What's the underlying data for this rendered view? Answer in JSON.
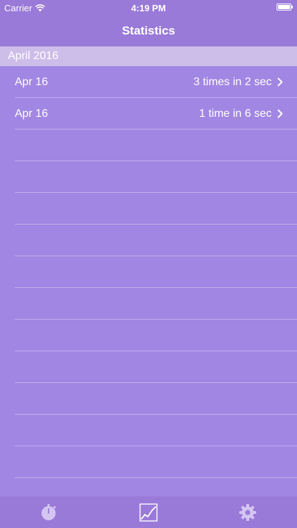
{
  "status_bar": {
    "carrier": "Carrier",
    "time": "4:19 PM"
  },
  "nav": {
    "title": "Statistics"
  },
  "section": {
    "header": "April 2016"
  },
  "rows": [
    {
      "date": "Apr 16",
      "summary": "3 times in 2 sec"
    },
    {
      "date": "Apr 16",
      "summary": "1 time in 6 sec"
    },
    {
      "date": "",
      "summary": ""
    },
    {
      "date": "",
      "summary": ""
    },
    {
      "date": "",
      "summary": ""
    },
    {
      "date": "",
      "summary": ""
    },
    {
      "date": "",
      "summary": ""
    },
    {
      "date": "",
      "summary": ""
    },
    {
      "date": "",
      "summary": ""
    },
    {
      "date": "",
      "summary": ""
    },
    {
      "date": "",
      "summary": ""
    },
    {
      "date": "",
      "summary": ""
    },
    {
      "date": "",
      "summary": ""
    },
    {
      "date": "",
      "summary": ""
    }
  ],
  "tabs": [
    {
      "icon": "stopwatch-icon",
      "selected": false
    },
    {
      "icon": "line-chart-icon",
      "selected": true
    },
    {
      "icon": "gear-icon",
      "selected": false
    }
  ],
  "colors": {
    "background": "#a286e3",
    "bars": "#9a7ad8",
    "section_header": "#cdbde9",
    "icon_inactive": "#d4c6f1",
    "icon_active": "#ffffff"
  }
}
